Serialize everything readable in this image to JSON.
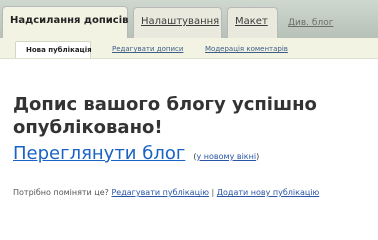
{
  "tabs": {
    "posting": "Надсилання дописів",
    "settings": "Налаштування",
    "layout": "Макет",
    "view_blog": "Див. блог"
  },
  "subtabs": {
    "new_post": "Нова публікація",
    "edit_posts": "Редагувати дописи",
    "moderate_comments": "Модерація коментарів"
  },
  "main": {
    "success_title": "Допис вашого блогу успішно опубліковано!",
    "view_blog_link": "Переглянути блог",
    "new_window_open": "(",
    "new_window_link": "у новому вікні",
    "new_window_close": ")",
    "need_edit_text": "Потрібно поміняти це?",
    "edit_post_link": "Редагувати публікацію",
    "separator": "|",
    "add_new_post_link": "Додати нову публікацію"
  }
}
